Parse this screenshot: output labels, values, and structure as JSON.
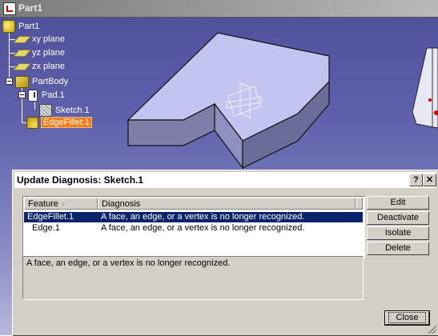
{
  "window": {
    "title": "Part1"
  },
  "tree": {
    "root": "Part1",
    "planes": [
      "xy plane",
      "yz plane",
      "zx plane"
    ],
    "body": "PartBody",
    "pad": "Pad.1",
    "sketch": "Sketch.1",
    "fillet": "EdgeFillet.1"
  },
  "dialog": {
    "title": "Update Diagnosis: Sketch.1",
    "help_glyph": "?",
    "close_glyph": "✕",
    "columns": [
      "Feature",
      "Diagnosis"
    ],
    "sort_icon": "sort-indicator-icon",
    "rows": [
      {
        "feature": "EdgeFillet.1",
        "diagnosis": "A face, an edge, or a vertex is no longer recognized.",
        "selected": true
      },
      {
        "feature": "Edge.1",
        "diagnosis": "A face, an edge, or a vertex is no longer recognized.",
        "selected": false
      }
    ],
    "message": "A face, an edge, or a vertex is no longer recognized.",
    "buttons": {
      "edit": "Edit",
      "deactivate": "Deactivate",
      "isolate": "Isolate",
      "delete": "Delete",
      "close": "Close"
    }
  },
  "colors": {
    "selection": "#0a246a",
    "tree_highlight": "#ff7b17",
    "part_face": "#c4c4f0",
    "background_top": "#4e4f9a"
  }
}
